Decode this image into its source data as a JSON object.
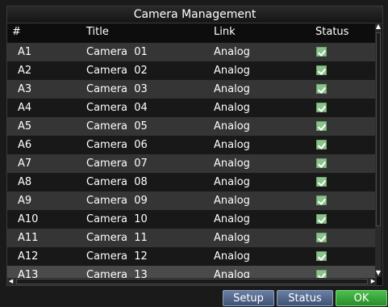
{
  "window": {
    "title": "Camera Management"
  },
  "columns": {
    "id": "#",
    "title": "Title",
    "link": "Link",
    "status": "Status"
  },
  "rows": [
    {
      "id": "A1",
      "title": "Camera  01",
      "link": "Analog",
      "status": true
    },
    {
      "id": "A2",
      "title": "Camera  02",
      "link": "Analog",
      "status": true
    },
    {
      "id": "A3",
      "title": "Camera  03",
      "link": "Analog",
      "status": true
    },
    {
      "id": "A4",
      "title": "Camera  04",
      "link": "Analog",
      "status": true
    },
    {
      "id": "A5",
      "title": "Camera  05",
      "link": "Analog",
      "status": true
    },
    {
      "id": "A6",
      "title": "Camera  06",
      "link": "Analog",
      "status": true
    },
    {
      "id": "A7",
      "title": "Camera  07",
      "link": "Analog",
      "status": true
    },
    {
      "id": "A8",
      "title": "Camera  08",
      "link": "Analog",
      "status": true
    },
    {
      "id": "A9",
      "title": "Camera  09",
      "link": "Analog",
      "status": true
    },
    {
      "id": "A10",
      "title": "Camera  10",
      "link": "Analog",
      "status": true
    },
    {
      "id": "A11",
      "title": "Camera  11",
      "link": "Analog",
      "status": true
    },
    {
      "id": "A12",
      "title": "Camera  12",
      "link": "Analog",
      "status": true
    },
    {
      "id": "A13",
      "title": "Camera  13",
      "link": "Analog",
      "status": true
    }
  ],
  "buttons": {
    "setup": "Setup",
    "status": "Status",
    "ok": "OK"
  },
  "colors": {
    "row_odd": "#353535",
    "row_even": "#181818",
    "check": "#8cc28c",
    "ok_button": "#3fae3f",
    "button": "#5a6f94"
  }
}
